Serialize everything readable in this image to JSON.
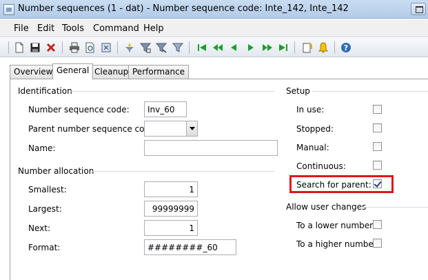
{
  "window": {
    "title": "Number sequences (1 - dat) - Number sequence code: Inte_142, Inte_142"
  },
  "menu": {
    "file": "File",
    "edit": "Edit",
    "tools": "Tools",
    "command": "Command",
    "help": "Help"
  },
  "tabs": {
    "overview": "Overview",
    "general": "General",
    "cleanup": "Cleanup",
    "performance": "Performance"
  },
  "identification": {
    "heading": "Identification",
    "code_label": "Number sequence code:",
    "code_value": "Inv_60",
    "parent_label": "Parent number sequence code:",
    "parent_value": "",
    "name_label": "Name:",
    "name_value": ""
  },
  "allocation": {
    "heading": "Number allocation",
    "smallest_label": "Smallest:",
    "smallest_value": "1",
    "largest_label": "Largest:",
    "largest_value": "99999999",
    "next_label": "Next:",
    "next_value": "1",
    "format_label": "Format:",
    "format_value": "########_60"
  },
  "setup": {
    "heading": "Setup",
    "in_use_label": "In use:",
    "in_use": false,
    "stopped_label": "Stopped:",
    "stopped": false,
    "manual_label": "Manual:",
    "manual": false,
    "continuous_label": "Continuous:",
    "continuous": false,
    "search_parent_label": "Search for parent:",
    "search_parent": true
  },
  "user_changes": {
    "heading": "Allow user changes",
    "lower_label": "To a lower number:",
    "lower": false,
    "higher_label": "To a higher number:",
    "higher": false
  },
  "colors": {
    "highlight": "#e0151b",
    "check": "#1e3f88"
  }
}
